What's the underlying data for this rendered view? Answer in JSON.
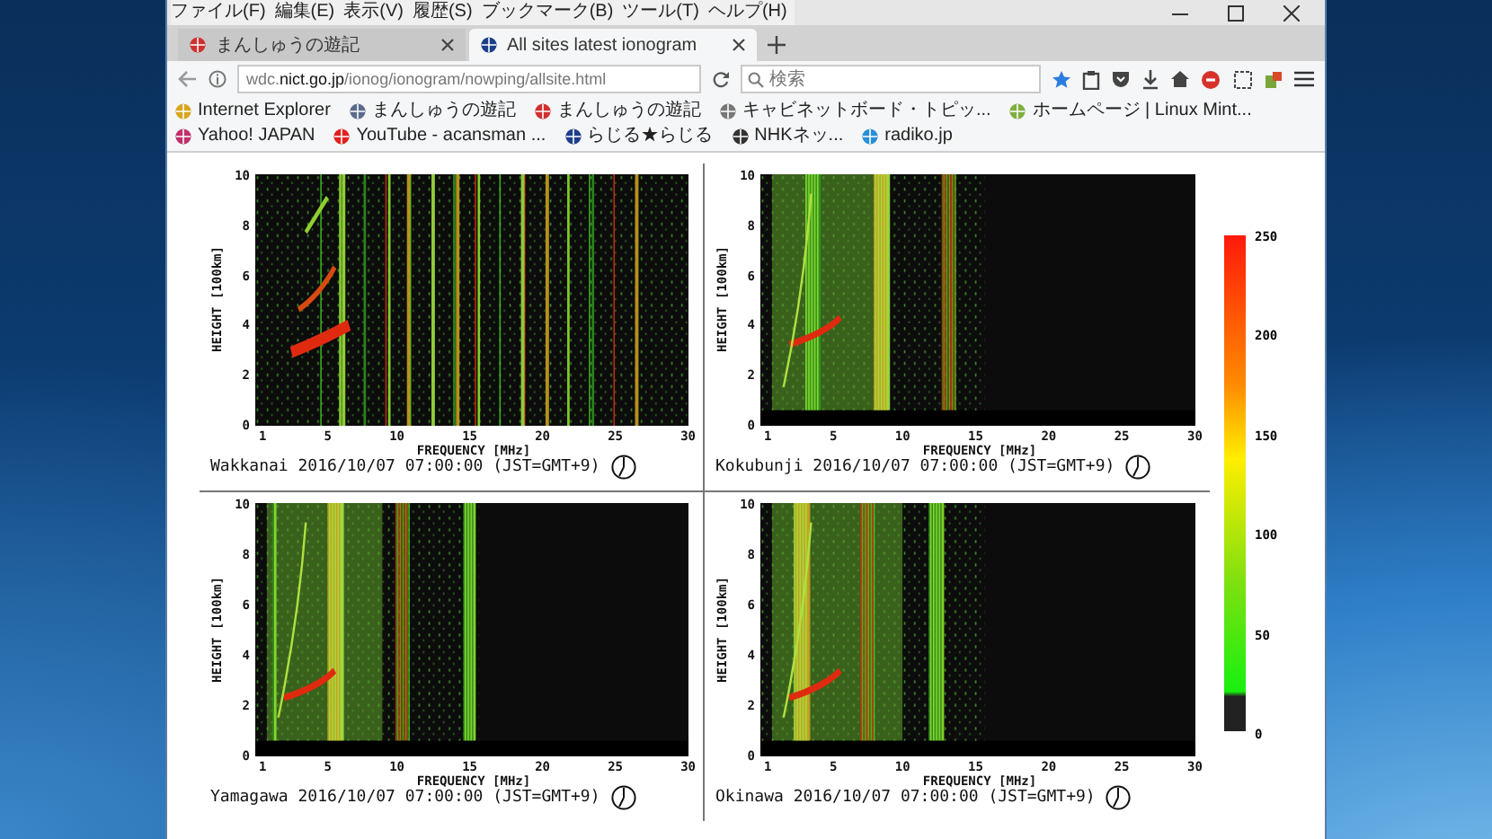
{
  "window": {
    "menu": [
      "ファイル(F)",
      "編集(E)",
      "表示(V)",
      "履歴(S)",
      "ブックマーク(B)",
      "ツール(T)",
      "ヘルプ(H)"
    ],
    "tabs": [
      {
        "title": "まんしゅうの遊記",
        "selected": false
      },
      {
        "title": "All sites latest ionogram",
        "selected": true
      }
    ],
    "url": "wdc.**nict.go.jp**/ionog/ionogram/nowping/allsite.html",
    "search": {
      "placeholder": "検索"
    },
    "bookmarks": [
      "Internet Explorer",
      "まんしゅうの遊記",
      "まんしゅうの遊記",
      "キャビネットボード・トピッ...",
      "ホームページ | Linux Mint...",
      "Yahoo! JAPAN",
      "YouTube - acansman ...",
      "らじる★らじる",
      "NHKネッ...",
      "radiko.jp"
    ]
  },
  "panels": [
    {
      "y_label": "HEIGHT [100km]",
      "y_ticks": [
        "10",
        "8",
        "6",
        "4",
        "2",
        "0"
      ],
      "x_ticks": [
        "1",
        "5",
        "10",
        "15",
        "20",
        "25",
        "30"
      ],
      "x_label": "FREQUENCY [MHz]",
      "caption": "Wakkanai 2016/10/07 07:00:00 (JST=GMT+9)"
    },
    {
      "y_label": "HEIGHT [100km]",
      "y_ticks": [
        "10",
        "8",
        "6",
        "4",
        "2",
        "0"
      ],
      "x_ticks": [
        "1",
        "5",
        "10",
        "15",
        "20",
        "25",
        "30"
      ],
      "x_label": "FREQUENCY [MHz]",
      "caption": "Kokubunji 2016/10/07 07:00:00 (JST=GMT+9)"
    },
    {
      "y_label": "HEIGHT [100km]",
      "y_ticks": [
        "10",
        "8",
        "6",
        "4",
        "2",
        "0"
      ],
      "x_ticks": [
        "1",
        "5",
        "10",
        "15",
        "20",
        "25",
        "30"
      ],
      "x_label": "FREQUENCY [MHz]",
      "caption": "Yamagawa 2016/10/07 07:00:00 (JST=GMT+9)"
    },
    {
      "y_label": "HEIGHT [100km]",
      "y_ticks": [
        "10",
        "8",
        "6",
        "4",
        "2",
        "0"
      ],
      "x_ticks": [
        "1",
        "5",
        "10",
        "15",
        "20",
        "25",
        "30"
      ],
      "x_label": "FREQUENCY [MHz]",
      "caption": "Okinawa 2016/10/07 07:00:00 (JST=GMT+9)"
    }
  ],
  "color_scale": {
    "ticks": [
      "250",
      "200",
      "150",
      "100",
      "50",
      "0"
    ]
  }
}
